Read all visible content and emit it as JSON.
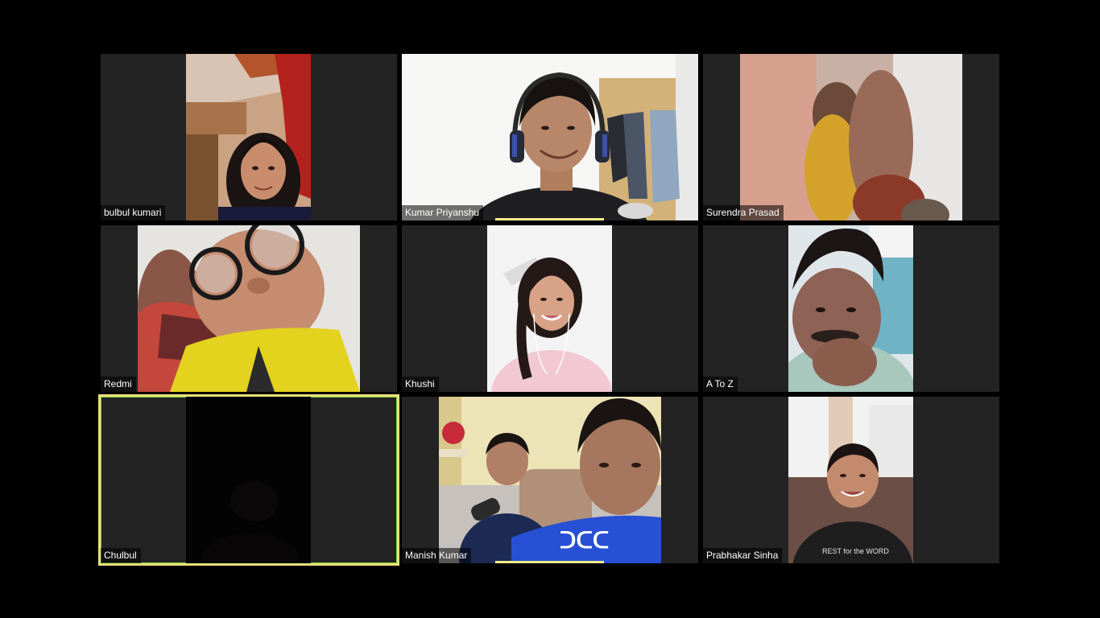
{
  "meeting": {
    "participants": [
      {
        "name": "bulbul kumari"
      },
      {
        "name": "Kumar Priyanshu"
      },
      {
        "name": "Surendra Prasad"
      },
      {
        "name": "Redmi"
      },
      {
        "name": "Khushi"
      },
      {
        "name": "A To Z"
      },
      {
        "name": "Chulbul"
      },
      {
        "name": "Manish Kumar"
      },
      {
        "name": "Prabhakar Sinha"
      }
    ],
    "active_speaker": "Chulbul"
  },
  "colors": {
    "background": "#000000",
    "tile_background": "#232323",
    "active_speaker_border": "#e8e07a",
    "active_speaker_border_side": "#7fd23a",
    "speaking_indicator": "#f3ec8a"
  }
}
